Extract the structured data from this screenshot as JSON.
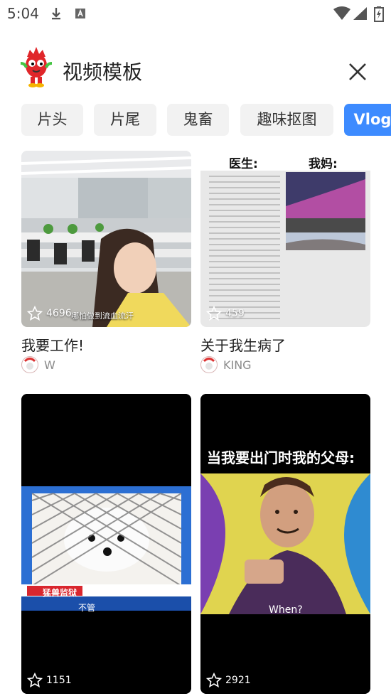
{
  "status_bar": {
    "time": "5:04",
    "icons": [
      "download-icon",
      "a-square-icon",
      "wifi-icon",
      "signal-icon",
      "battery-icon"
    ]
  },
  "header": {
    "title": "视频模板",
    "close_icon": "close-icon"
  },
  "tabs": [
    {
      "label": "片头"
    },
    {
      "label": "片尾"
    },
    {
      "label": "鬼畜"
    },
    {
      "label": "趣味抠图"
    },
    {
      "label": "Vlog",
      "active": true
    }
  ],
  "cards": [
    {
      "count": "4696",
      "subtitle_text": "哪怕做到流血流汗",
      "caption": "我要工作!",
      "author": "W"
    },
    {
      "count": "459",
      "overlay_left": "医生:",
      "overlay_right": "我妈:",
      "caption": "关于我生病了",
      "author": "KING"
    },
    {
      "count": "1151",
      "banner_label": "猛兽监狱",
      "subtitle_text": "不管"
    },
    {
      "count": "2921",
      "headline": "当我要出门时我的父母:",
      "subtitle_text": "When?"
    }
  ],
  "colors": {
    "accent": "#3d8bff",
    "tab_bg": "#f2f2f2"
  }
}
